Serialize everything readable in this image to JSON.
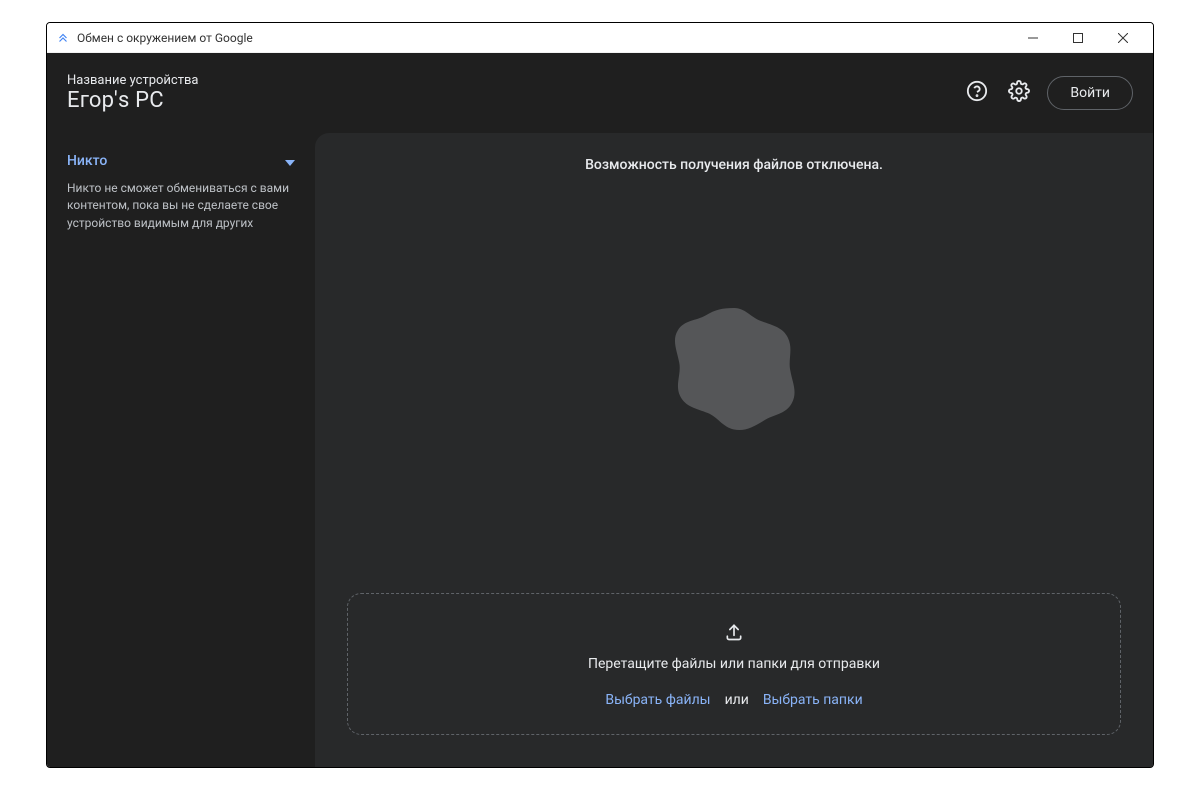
{
  "window": {
    "title": "Обмен с окружением от Google"
  },
  "header": {
    "device_label": "Название устройства",
    "device_name": "Егор's PC",
    "signin_label": "Войти"
  },
  "sidebar": {
    "visibility_value": "Никто",
    "visibility_description": "Никто не сможет обмениваться с вами контентом, пока вы не сделаете свое устройство видимым для других"
  },
  "main": {
    "status_text": "Возможность получения файлов отключена.",
    "drop_text": "Перетащите файлы или папки для отправки",
    "select_files_label": "Выбрать файлы",
    "or_label": "или",
    "select_folders_label": "Выбрать папки"
  },
  "colors": {
    "accent": "#8ab4f8",
    "bg_dark": "#1f1f1f",
    "panel": "#28292a"
  }
}
